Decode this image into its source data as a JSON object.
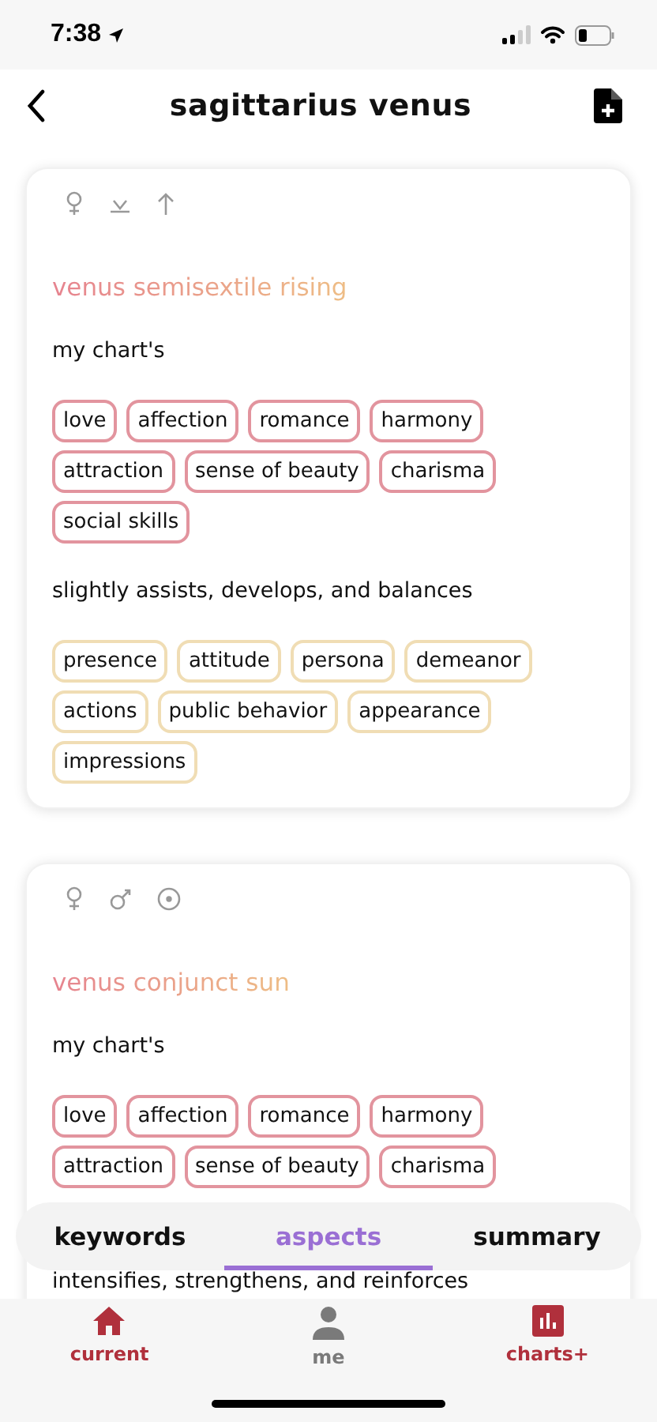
{
  "status_bar": {
    "time": "7:38"
  },
  "nav": {
    "title": "sagittarius venus"
  },
  "cards": [
    {
      "symbols": [
        {
          "kind": "venus"
        },
        {
          "kind": "semisextile"
        },
        {
          "kind": "rising"
        }
      ],
      "title": "venus semisextile rising",
      "groups": [
        {
          "label": "my chart's",
          "color": "#e2949e",
          "tags": [
            "love",
            "affection",
            "romance",
            "harmony",
            "attraction",
            "sense of beauty",
            "charisma",
            "social skills"
          ]
        },
        {
          "label": "slightly assists, develops, and balances",
          "color": "#f0ddb4",
          "tags": [
            "presence",
            "attitude",
            "persona",
            "demeanor",
            "actions",
            "public behavior",
            "appearance",
            "impressions"
          ]
        }
      ]
    },
    {
      "symbols": [
        {
          "kind": "venus"
        },
        {
          "kind": "conjunct"
        },
        {
          "kind": "sun"
        }
      ],
      "title": "venus conjunct sun",
      "groups": [
        {
          "label": "my chart's",
          "color": "#e2949e",
          "tags": [
            "love",
            "affection",
            "romance",
            "harmony",
            "attraction",
            "sense of beauty",
            "charisma"
          ]
        },
        {
          "label": "intensifies, strengthens, and reinforces"
        }
      ]
    }
  ],
  "segments": [
    {
      "label": "keywords",
      "selected": false
    },
    {
      "label": "aspects",
      "selected": true
    },
    {
      "label": "summary",
      "selected": false
    }
  ],
  "tab_bar": [
    {
      "kind": "home",
      "label": "current",
      "highlighted": true
    },
    {
      "kind": "person",
      "label": "me",
      "highlighted": false
    },
    {
      "kind": "chart",
      "label": "charts+",
      "highlighted": true
    }
  ]
}
